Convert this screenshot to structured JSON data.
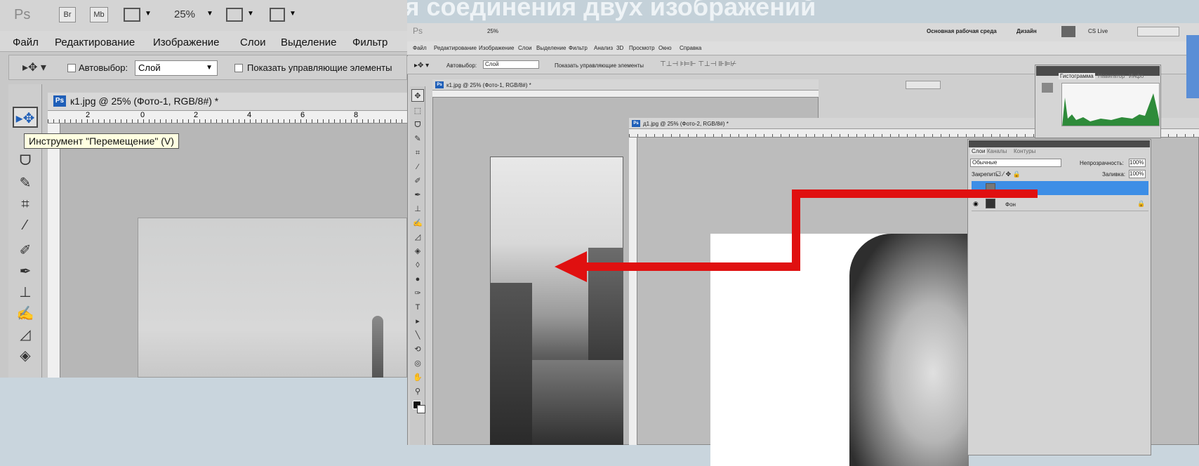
{
  "slide": {
    "title": "Инструмент «Перемещение» для соединения двух изображений"
  },
  "left_window": {
    "app_logo": "Ps",
    "app_buttons": [
      "Br",
      "Mb"
    ],
    "zoom": "25%",
    "menu": [
      "Файл",
      "Редактирование",
      "Изображение",
      "Слои",
      "Выделение",
      "Фильтр"
    ],
    "options": {
      "autoselect_label": "Автовыбор:",
      "autoselect_value": "Слой",
      "show_controls_label": "Показать управляющие элементы"
    },
    "doc_tab": "к1.jpg @ 25% (Фото-1, RGB/8#) *",
    "tooltip": "Инструмент \"Перемещение\" (V)",
    "ruler_numbers": [
      "2",
      "0",
      "2",
      "4",
      "6",
      "8"
    ]
  },
  "right_window": {
    "app_logo": "Ps",
    "zoom": "25%",
    "menu": [
      "Файл",
      "Редактирование",
      "Изображение",
      "Слои",
      "Выделение",
      "Фильтр",
      "Анализ",
      "3D",
      "Просмотр",
      "Окно",
      "Справка"
    ],
    "workspace": "Основная рабочая среда",
    "design": "Дизайн",
    "cs_live": "CS Live",
    "options": {
      "autoselect_label": "Автовыбор:",
      "autoselect_value": "Слой",
      "show_controls_label": "Показать управляющие элементы"
    },
    "doc1_tab": "к1.jpg @ 25% (Фото-1, RGB/8#) *",
    "doc2_tab": "д1.jpg @ 25% (Фото-2, RGB/8#) *",
    "histogram": {
      "tabs": [
        "Гистограмма",
        "Навигатор",
        "Инфо"
      ]
    },
    "layers": {
      "tabs": [
        "Слои",
        "Каналы",
        "Контуры"
      ],
      "blend": "Обычные",
      "opacity_label": "Непрозрачность:",
      "opacity_value": "100%",
      "lock_label": "Закрепить:",
      "fill_label": "Заливка:",
      "fill_value": "100%",
      "background_layer": "Фон"
    }
  },
  "colors": {
    "arrow": "#e01010",
    "selection": "#3d8ee6",
    "ps_blue": "#1f5fb8"
  }
}
